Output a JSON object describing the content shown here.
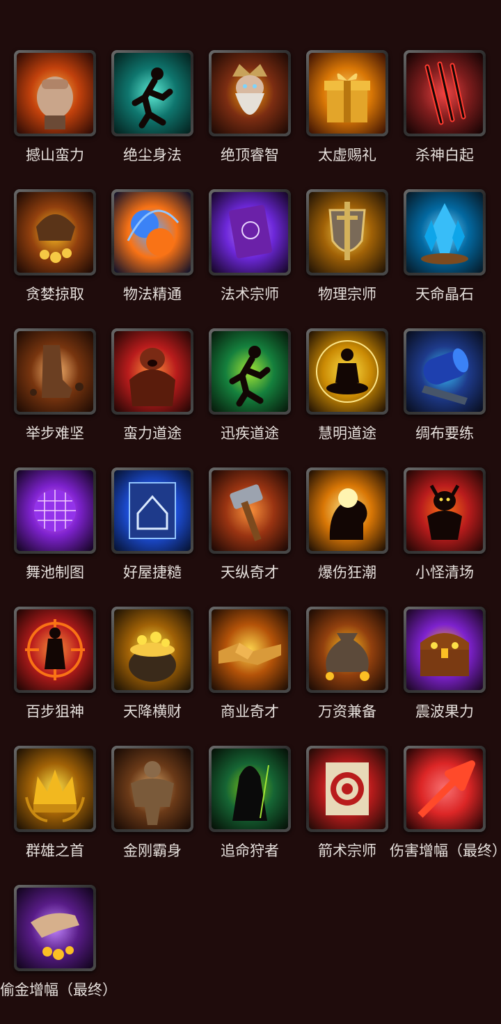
{
  "skills": [
    {
      "name": "撼山蛮力",
      "icon": "fist-icon",
      "colors": [
        "#ffb347",
        "#c2410c",
        "#2a0a05"
      ]
    },
    {
      "name": "绝尘身法",
      "icon": "running-figure-icon",
      "colors": [
        "#5eead4",
        "#0f766e",
        "#04201d"
      ]
    },
    {
      "name": "绝顶睿智",
      "icon": "bearded-sage-icon",
      "colors": [
        "#f59e0b",
        "#7c2d12",
        "#1c0904"
      ]
    },
    {
      "name": "太虚赐礼",
      "icon": "gift-box-icon",
      "colors": [
        "#ffd166",
        "#d97706",
        "#3b1104"
      ]
    },
    {
      "name": "杀神白起",
      "icon": "claw-slash-icon",
      "colors": [
        "#ef4444",
        "#7f1d1d",
        "#120303"
      ]
    },
    {
      "name": "贪婪掠取",
      "icon": "greed-claw-icon",
      "colors": [
        "#fbbf24",
        "#92400e",
        "#1a0804"
      ]
    },
    {
      "name": "物法精通",
      "icon": "twin-orbs-icon",
      "colors": [
        "#60a5fa",
        "#f97316",
        "#0b0f2a"
      ]
    },
    {
      "name": "法术宗师",
      "icon": "spellbook-icon",
      "colors": [
        "#c084fc",
        "#6d28d9",
        "#150525"
      ]
    },
    {
      "name": "物理宗师",
      "icon": "sword-shield-icon",
      "colors": [
        "#fcd34d",
        "#a16207",
        "#1f1205"
      ]
    },
    {
      "name": "天命晶石",
      "icon": "crystal-icon",
      "colors": [
        "#7dd3fc",
        "#0369a1",
        "#061825"
      ]
    },
    {
      "name": "举步难坚",
      "icon": "stomp-foot-icon",
      "colors": [
        "#fdba74",
        "#78350f",
        "#1c0a03"
      ]
    },
    {
      "name": "蛮力道途",
      "icon": "roaring-brute-icon",
      "colors": [
        "#fb923c",
        "#b91c1c",
        "#200604"
      ]
    },
    {
      "name": "迅疾道途",
      "icon": "sprinter-icon",
      "colors": [
        "#a3e635",
        "#15803d",
        "#06180a"
      ]
    },
    {
      "name": "慧明道途",
      "icon": "meditating-figure-icon",
      "colors": [
        "#fde047",
        "#ca8a04",
        "#1f1004"
      ]
    },
    {
      "name": "绸布要练",
      "icon": "cloth-roll-icon",
      "colors": [
        "#38bdf8",
        "#1e3a8a",
        "#080d1c"
      ]
    },
    {
      "name": "舞池制图",
      "icon": "disco-ball-icon",
      "colors": [
        "#e879f9",
        "#7e22ce",
        "#12041f"
      ]
    },
    {
      "name": "好屋捷糙",
      "icon": "house-blueprint-icon",
      "colors": [
        "#60a5fa",
        "#1d4ed8",
        "#061230"
      ]
    },
    {
      "name": "天纵奇才",
      "icon": "hammer-icon",
      "colors": [
        "#fb923c",
        "#9a3412",
        "#1a0704"
      ]
    },
    {
      "name": "爆伤狂潮",
      "icon": "brain-burst-icon",
      "colors": [
        "#fde68a",
        "#d97706",
        "#1c0e04"
      ]
    },
    {
      "name": "小怪清场",
      "icon": "imp-demon-icon",
      "colors": [
        "#f97316",
        "#b91c1c",
        "#1f0604"
      ]
    },
    {
      "name": "百步狙神",
      "icon": "crosshair-target-icon",
      "colors": [
        "#fb923c",
        "#b91c1c",
        "#1c0503"
      ]
    },
    {
      "name": "天降横财",
      "icon": "pot-of-gold-icon",
      "colors": [
        "#fde047",
        "#a16207",
        "#1a1004"
      ]
    },
    {
      "name": "商业奇才",
      "icon": "handshake-icon",
      "colors": [
        "#fcd34d",
        "#b45309",
        "#1c0c04"
      ]
    },
    {
      "name": "万资兼备",
      "icon": "money-bag-icon",
      "colors": [
        "#fbbf24",
        "#92400e",
        "#1a0a04"
      ]
    },
    {
      "name": "震波果力",
      "icon": "treasure-chest-icon",
      "colors": [
        "#fbbf24",
        "#7e22ce",
        "#1a0620"
      ]
    },
    {
      "name": "群雄之首",
      "icon": "crown-icon",
      "colors": [
        "#fde047",
        "#a16207",
        "#1a0f04"
      ]
    },
    {
      "name": "金刚霸身",
      "icon": "stone-golem-icon",
      "colors": [
        "#d6a56b",
        "#6b3a18",
        "#160904"
      ]
    },
    {
      "name": "追命狩者",
      "icon": "hooded-hunter-icon",
      "colors": [
        "#84cc16",
        "#166534",
        "#050f06"
      ]
    },
    {
      "name": "箭术宗师",
      "icon": "archery-target-icon",
      "colors": [
        "#fca5a5",
        "#b91c1c",
        "#1f0a06"
      ]
    },
    {
      "name": "伤害增幅（最终）",
      "icon": "red-arrow-icon",
      "colors": [
        "#f87171",
        "#dc2626",
        "#200404"
      ]
    },
    {
      "name": "偷金增幅（最终）",
      "icon": "stealing-hand-icon",
      "colors": [
        "#c084fc",
        "#581c87",
        "#10041a"
      ]
    }
  ]
}
